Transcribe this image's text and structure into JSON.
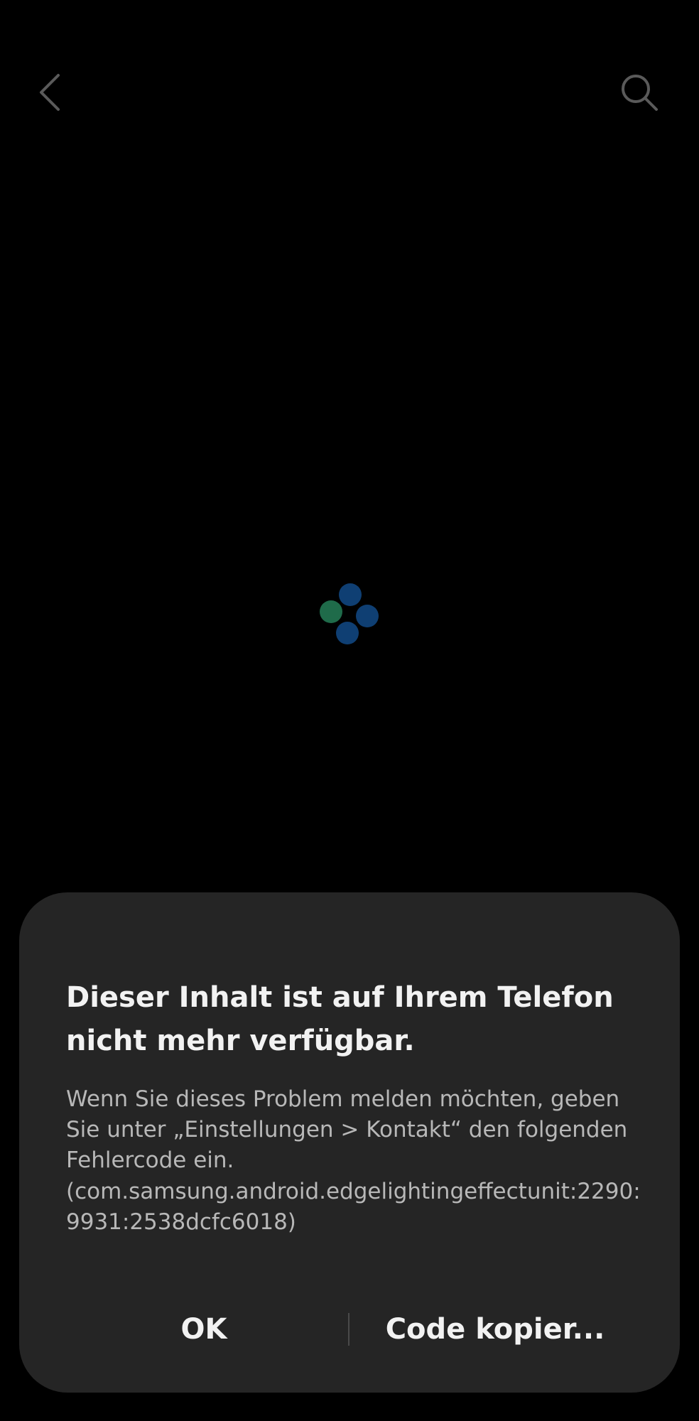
{
  "header": {
    "back_icon": "chevron-left-icon",
    "search_icon": "search-icon"
  },
  "loading": {
    "indicator": "loading-dots",
    "colors": {
      "green": "#1f6b4a",
      "blue": "#0f3f73"
    }
  },
  "dialog": {
    "title": "Dieser Inhalt ist auf Ihrem Telefon nicht mehr verfügbar.",
    "message": "Wenn Sie dieses Problem melden möchten, geben Sie unter „Einstellungen > Kontakt“ den folgenden Fehlercode ein.",
    "error_code": "(com.samsung.android.edgelightingeffectunit:2290:9931:2538dcfc6018)",
    "ok_label": "OK",
    "copy_label": "Code kopier..."
  },
  "colors": {
    "background": "#000000",
    "dialog_background": "#252525",
    "title_text": "#f2f2f2",
    "body_text": "#b8b8b8"
  }
}
